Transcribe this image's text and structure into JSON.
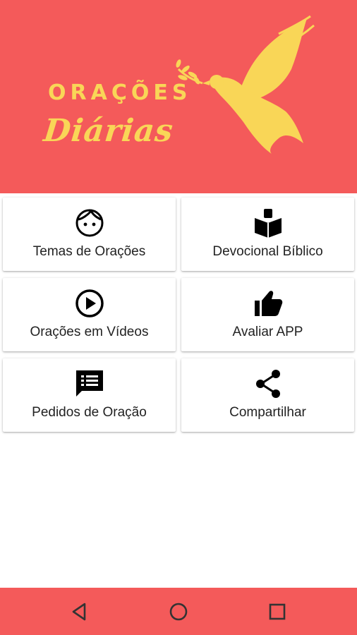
{
  "header": {
    "logo_title": "ORAÇÕES",
    "logo_subtitle": "Diárias",
    "background_color": "#f45a5a",
    "logo_color": "#f9d657",
    "logo_icon": "dove-icon"
  },
  "menu": {
    "items": [
      {
        "label": "Temas de Orações",
        "icon": "face-icon"
      },
      {
        "label": "Devocional Bíblico",
        "icon": "book-reader-icon"
      },
      {
        "label": "Orações em Vídeos",
        "icon": "play-circle-icon"
      },
      {
        "label": "Avaliar APP",
        "icon": "thumbs-up-icon"
      },
      {
        "label": "Pedidos de Oração",
        "icon": "message-icon"
      },
      {
        "label": "Compartilhar",
        "icon": "share-icon"
      }
    ]
  },
  "navbar": {
    "background_color": "#f45a5a",
    "buttons": [
      "back-icon",
      "home-icon",
      "recents-icon"
    ]
  }
}
